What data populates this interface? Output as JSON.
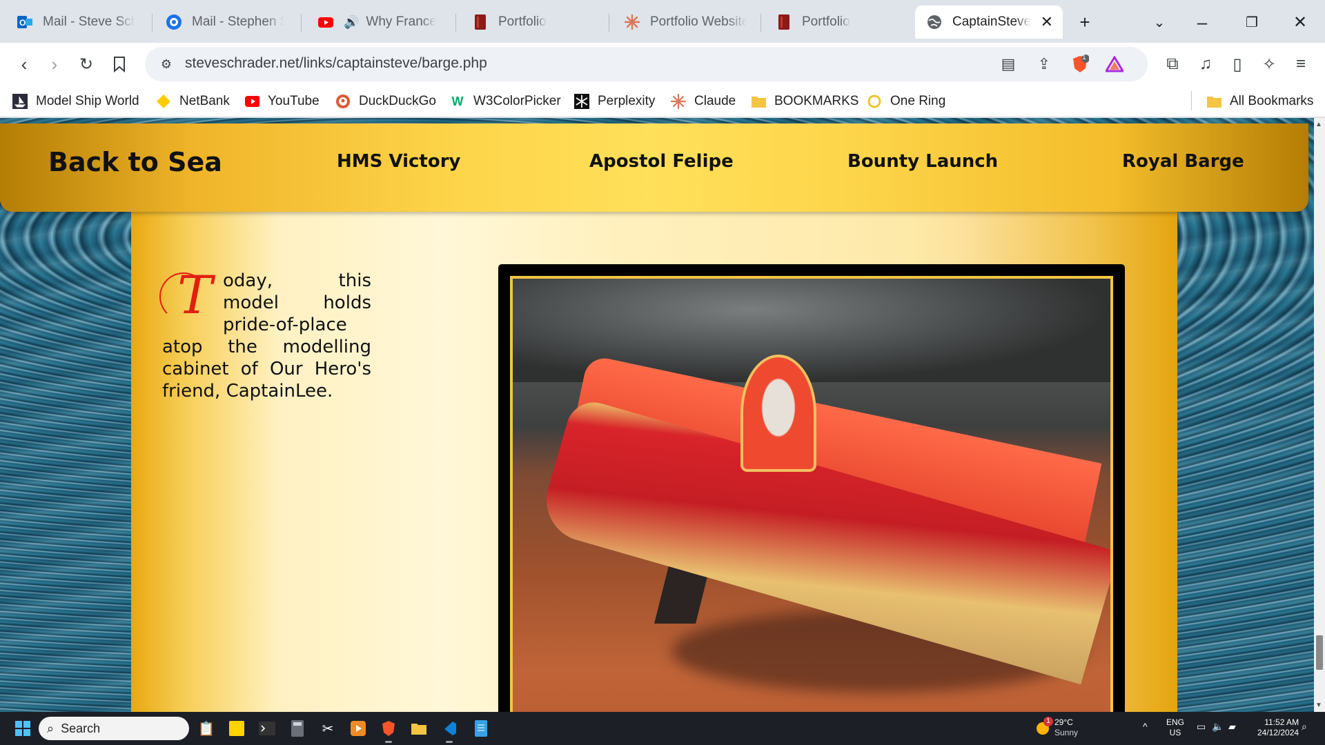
{
  "tabs": [
    {
      "title": "Mail - Steve Schrader",
      "icon": "outlook-icon",
      "color": "#0a64c8"
    },
    {
      "title": "Mail - Stephen Schrader",
      "icon": "mail-client-icon",
      "color": "#1a73e8"
    },
    {
      "title": "Why France and",
      "icon": "youtube-icon",
      "color": "#ff0000",
      "audio": true
    },
    {
      "title": "Portfolio",
      "icon": "portfolio-icon",
      "color": "#8b1a1a"
    },
    {
      "title": "Portfolio Website",
      "icon": "claude-icon",
      "color": "#d97757"
    },
    {
      "title": "Portfolio",
      "icon": "portfolio-icon",
      "color": "#8b1a1a"
    },
    {
      "title": "CaptainSteve",
      "icon": "globe-icon",
      "color": "#3c4043",
      "active": true
    }
  ],
  "address": {
    "url": "steveschrader.net/links/captainsteve/barge.php"
  },
  "brave_badge": "1",
  "bookmarks": [
    {
      "label": "Model Ship World",
      "icon": "msw-icon"
    },
    {
      "label": "NetBank",
      "icon": "netbank-icon"
    },
    {
      "label": "YouTube",
      "icon": "youtube-icon"
    },
    {
      "label": "DuckDuckGo",
      "icon": "duckduckgo-icon"
    },
    {
      "label": "W3ColorPicker",
      "icon": "w3schools-icon"
    },
    {
      "label": "Perplexity",
      "icon": "perplexity-icon"
    },
    {
      "label": "Claude",
      "icon": "claude-icon"
    },
    {
      "label": "BOOKMARKS",
      "icon": "folder-icon"
    },
    {
      "label": "One Ring",
      "icon": "ring-icon"
    },
    {
      "label": "All Bookmarks",
      "icon": "folder-icon"
    }
  ],
  "site": {
    "brand": "Back to Sea",
    "nav": [
      "HMS Victory",
      "Apostol Felipe",
      "Bounty Launch",
      "Royal Barge"
    ],
    "dropcap": "T",
    "paragraph": "oday, this model holds pride-of-place atop the modelling cabinet of Our Hero's friend, CaptainLee."
  },
  "taskbar": {
    "search_placeholder": "Search",
    "weather_temp": "29°C",
    "weather_desc": "Sunny",
    "weather_badge": "1",
    "lang_top": "ENG",
    "lang_bottom": "US",
    "time": "11:52 AM",
    "date": "24/12/2024"
  },
  "colors": {
    "accent_gold": "#fdd54a",
    "dropcap_red": "#e02010",
    "frame_gold": "#f5c542"
  }
}
